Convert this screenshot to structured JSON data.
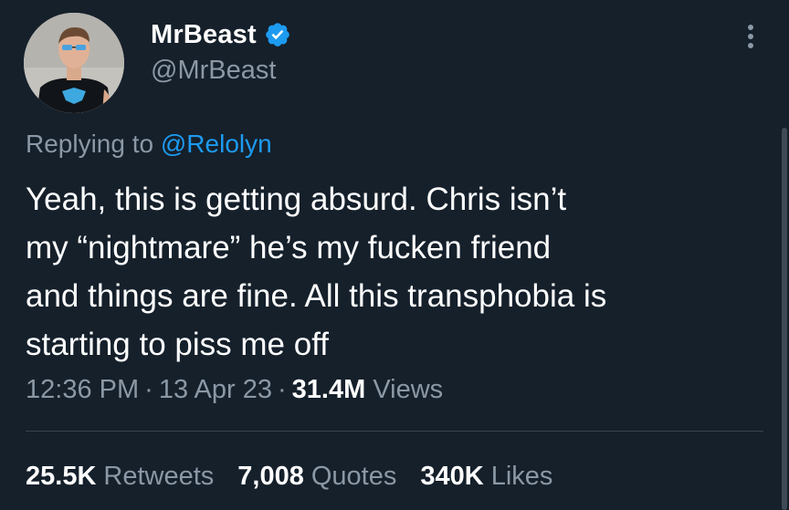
{
  "author": {
    "display_name": "MrBeast",
    "handle": "@MrBeast",
    "verified": true,
    "verified_color": "#1d9bf0"
  },
  "reply": {
    "prefix": "Replying to ",
    "target": "@Relolyn"
  },
  "tweet": {
    "text": "Yeah, this is getting absurd. Chris isn’t\nmy “nightmare” he’s my fucken friend\nand things are fine. All this transphobia is\nstarting to piss me off"
  },
  "meta": {
    "time": "12:36 PM",
    "separator": "·",
    "date": "13 Apr 23",
    "views_count": "31.4M",
    "views_label": "Views"
  },
  "stats": [
    {
      "count": "25.5K",
      "label": "Retweets"
    },
    {
      "count": "7,008",
      "label": "Quotes"
    },
    {
      "count": "340K",
      "label": "Likes"
    }
  ],
  "colors": {
    "background": "#15202b",
    "text_primary": "#ffffff",
    "text_secondary": "#8b98a5",
    "link": "#1d9bf0",
    "divider": "#38444d"
  },
  "icons": {
    "verified": "verified-badge-icon",
    "more": "more-options-icon"
  }
}
